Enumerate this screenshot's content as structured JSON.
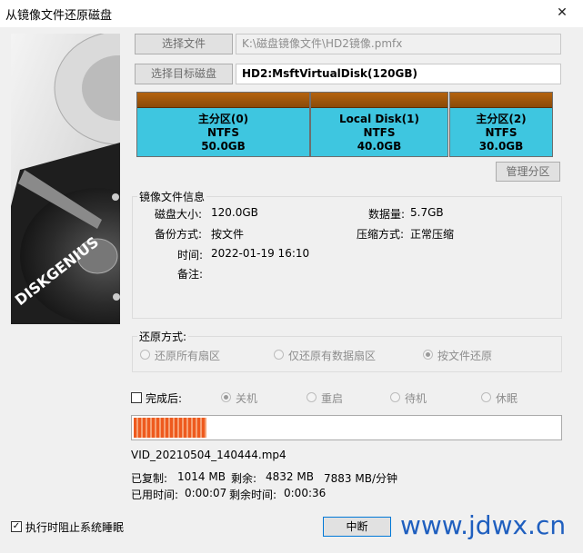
{
  "window": {
    "title": "从镜像文件还原磁盘",
    "close": "✕"
  },
  "source": {
    "select_file_label": "选择文件",
    "file_path": "K:\\磁盘镜像文件\\HD2镜像.pmfx",
    "select_target_label": "选择目标磁盘",
    "target_disk": "HD2:MsftVirtualDisk(120GB)"
  },
  "partitions": [
    {
      "name": "主分区(0)",
      "fs": "NTFS",
      "size": "50.0GB"
    },
    {
      "name": "Local Disk(1)",
      "fs": "NTFS",
      "size": "40.0GB"
    },
    {
      "name": "主分区(2)",
      "fs": "NTFS",
      "size": "30.0GB"
    }
  ],
  "manage_partition_label": "管理分区",
  "image_info": {
    "group_title": "镜像文件信息",
    "disk_size_label": "磁盘大小:",
    "disk_size": "120.0GB",
    "data_amount_label": "数据量:",
    "data_amount": "5.7GB",
    "backup_mode_label": "备份方式:",
    "backup_mode": "按文件",
    "compress_label": "压缩方式:",
    "compress": "正常压缩",
    "time_label": "时间:",
    "time": "2022-01-19 16:10",
    "note_label": "备注:"
  },
  "restore": {
    "group_title": "还原方式:",
    "options": [
      "还原所有扇区",
      "仅还原有数据扇区",
      "按文件还原"
    ],
    "selected": "按文件还原"
  },
  "after": {
    "label": "完成后:",
    "checked": false,
    "options": [
      "关机",
      "重启",
      "待机",
      "休眠"
    ],
    "selected": "关机"
  },
  "progress": {
    "fraction": 0.17
  },
  "current_file": "VID_20210504_140444.mp4",
  "stats": {
    "copied_label": "已复制:",
    "copied": "1014 MB",
    "remaining_label": "剩余:",
    "remaining": "4832 MB",
    "speed": "7883 MB/分钟",
    "elapsed_label": "已用时间:",
    "elapsed": "0:00:07",
    "time_left_label": "剩余时间:",
    "time_left": "0:00:36"
  },
  "prevent_sleep": {
    "label": "执行时阻止系统睡眠",
    "checked": true
  },
  "stop_label": "中断",
  "watermark": "www.jdwx.cn"
}
